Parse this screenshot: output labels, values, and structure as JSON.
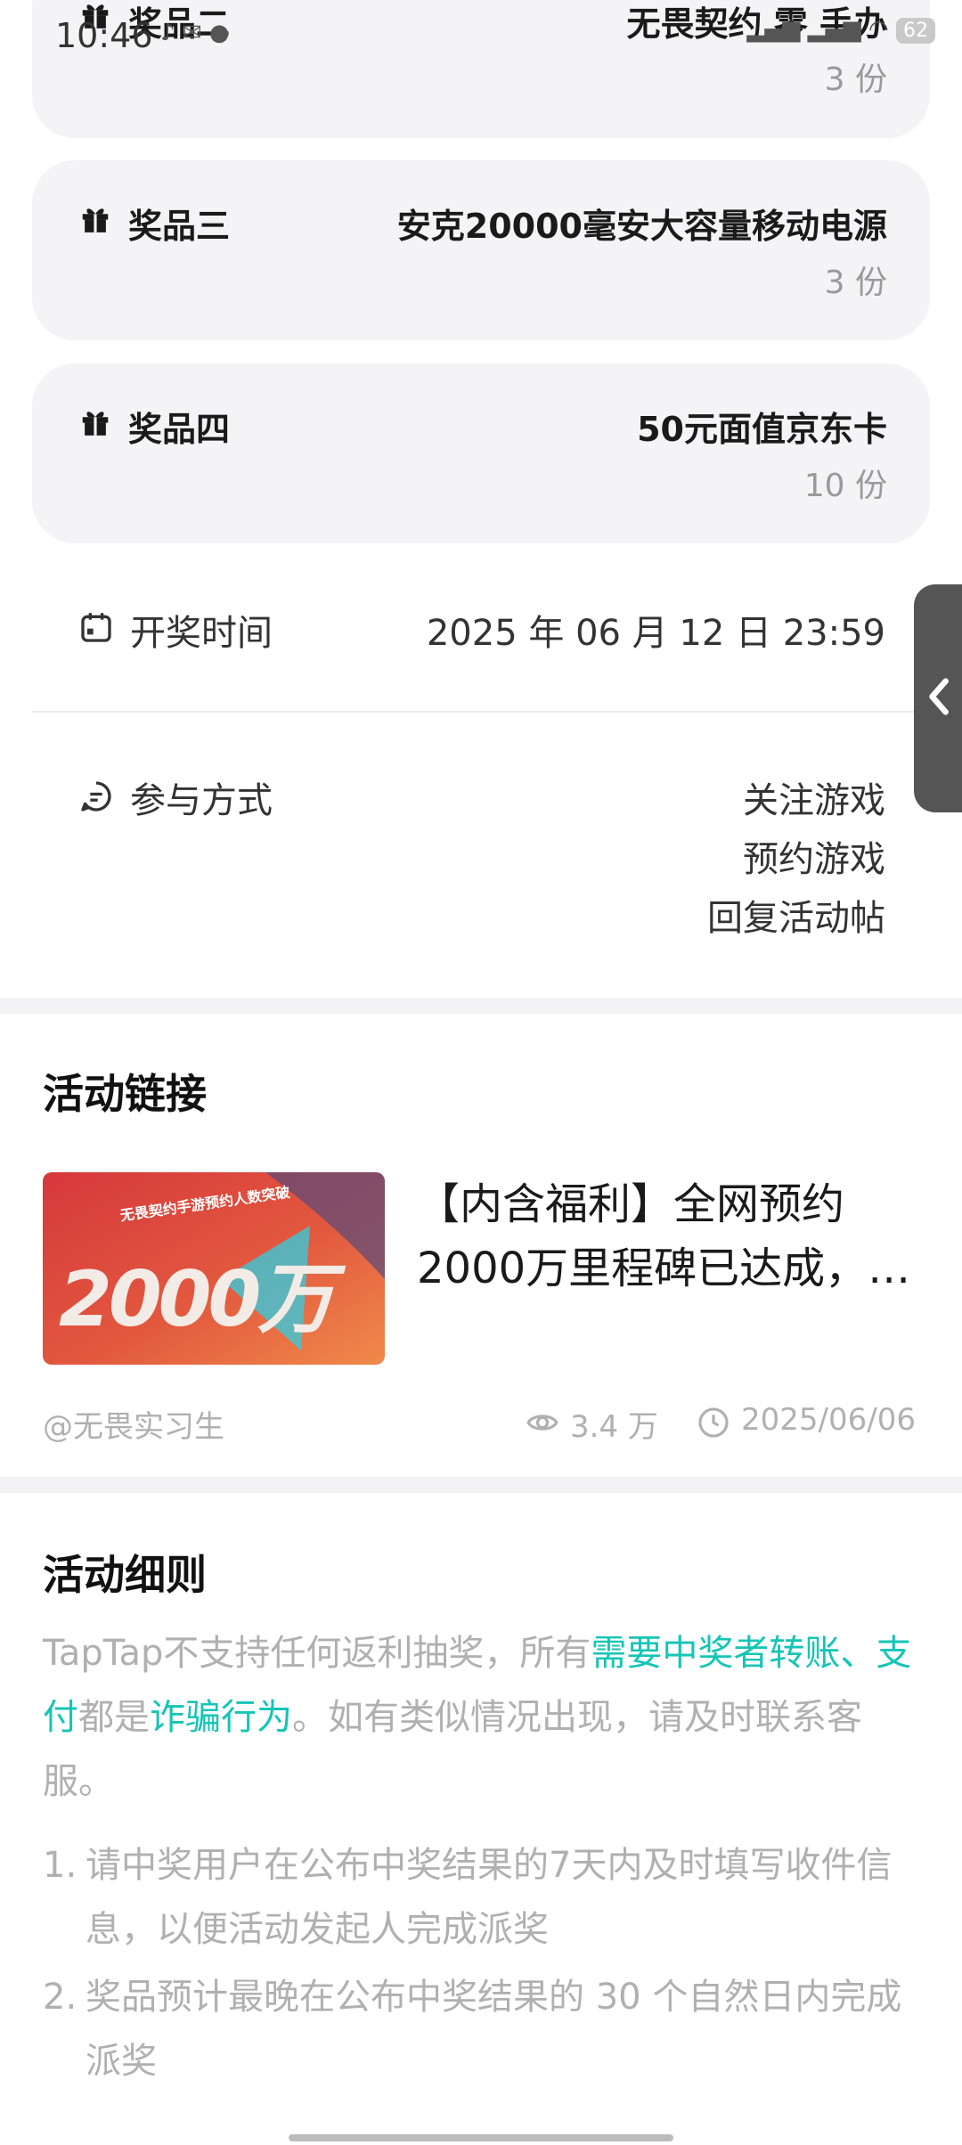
{
  "status_bar": {
    "time": "10:46",
    "battery": "62"
  },
  "prizes": [
    {
      "label": "奖品二",
      "name": "无畏契约 零 手办",
      "qty": "3 份"
    },
    {
      "label": "奖品三",
      "name": "安克20000毫安大容量移动电源",
      "qty": "3 份"
    },
    {
      "label": "奖品四",
      "name": "50元面值京东卡",
      "qty": "10 份"
    }
  ],
  "draw_time": {
    "label": "开奖时间",
    "value": "2025 年 06 月 12 日 23:59"
  },
  "participation": {
    "label": "参与方式",
    "methods": [
      "关注游戏",
      "预约游戏",
      "回复活动帖"
    ]
  },
  "activity_link": {
    "section_title": "活动链接",
    "post_title": "【内含福利】全网预约2000万里程碑已达成，…",
    "author": "@无畏实习生",
    "views": "3.4 万",
    "date": "2025/06/06",
    "thumb_caption": "无畏契约手游预约人数突破",
    "thumb_big": "2000万"
  },
  "rules": {
    "section_title": "活动细则",
    "intro_1": "TapTap不支持任何返利抽奖，所有",
    "intro_hl1": "需要中奖者转账、支付",
    "intro_2": "都是",
    "intro_hl2": "诈骗行为",
    "intro_3": "。如有类似情况出现，请及时联系客服。",
    "items": [
      {
        "num": "1.",
        "text": "请中奖用户在公布中奖结果的7天内及时填写收件信息，以便活动发起人完成派奖"
      },
      {
        "num": "2.",
        "text": "奖品预计最晚在公布中奖结果的 30 个自然日内完成派奖"
      }
    ]
  },
  "colors": {
    "accent": "#15c5b6",
    "card_bg": "#f4f4f6",
    "muted": "#b0b0b0"
  }
}
